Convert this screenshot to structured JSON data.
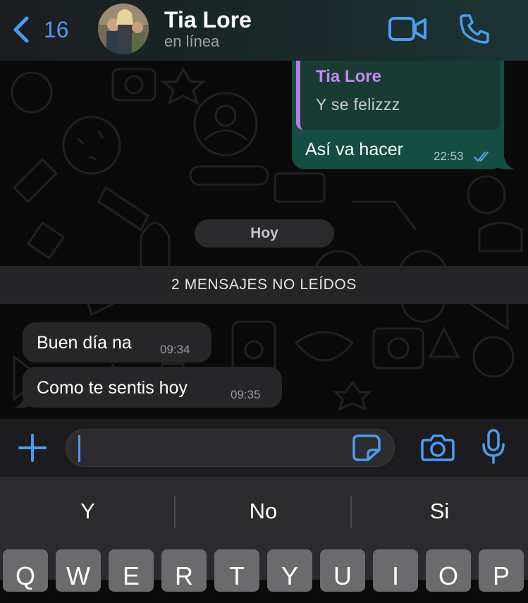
{
  "header": {
    "back_count": "16",
    "contact_name": "Tia Lore",
    "contact_status": "en línea"
  },
  "messages": {
    "outgoing": {
      "quote_author": "Tia Lore",
      "quote_text": "Y se felizzz",
      "text": "Así va hacer",
      "time": "22:53"
    },
    "date_chip": "Hoy",
    "unread_banner": "2 MENSAJES NO LEÍDOS",
    "incoming": [
      {
        "text": "Buen día na",
        "time": "09:34"
      },
      {
        "text": "Como te sentis hoy",
        "time": "09:35"
      }
    ]
  },
  "composer": {
    "input_value": ""
  },
  "keyboard": {
    "suggestions": [
      "Y",
      "No",
      "Si"
    ],
    "top_row": [
      "Q",
      "W",
      "E",
      "R",
      "T",
      "Y",
      "U",
      "I",
      "O",
      "P"
    ]
  },
  "colors": {
    "accent": "#4a9cf0",
    "outgoing_bubble": "#144d41",
    "incoming_bubble": "#262628",
    "quote_author": "#c18af0"
  }
}
